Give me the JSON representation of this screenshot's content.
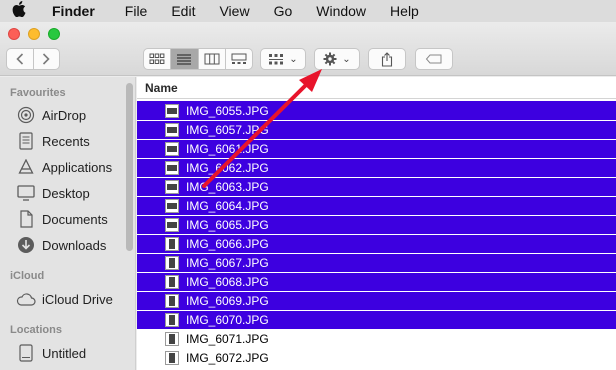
{
  "menubar": {
    "app": "Finder",
    "menus": [
      "File",
      "Edit",
      "View",
      "Go",
      "Window",
      "Help"
    ]
  },
  "sidebar": {
    "sections": [
      {
        "header": "Favourites",
        "items": [
          {
            "label": "AirDrop",
            "icon": "airdrop-icon"
          },
          {
            "label": "Recents",
            "icon": "recents-icon"
          },
          {
            "label": "Applications",
            "icon": "applications-icon"
          },
          {
            "label": "Desktop",
            "icon": "desktop-icon"
          },
          {
            "label": "Documents",
            "icon": "documents-icon"
          },
          {
            "label": "Downloads",
            "icon": "downloads-icon"
          }
        ]
      },
      {
        "header": "iCloud",
        "items": [
          {
            "label": "iCloud Drive",
            "icon": "cloud-icon"
          }
        ]
      },
      {
        "header": "Locations",
        "items": [
          {
            "label": "Untitled",
            "icon": "disk-icon"
          }
        ]
      }
    ]
  },
  "filelist": {
    "column_header": "Name",
    "files": [
      {
        "name": "IMG_6055.JPG",
        "selected": true,
        "orientation": "landscape"
      },
      {
        "name": "IMG_6057.JPG",
        "selected": true,
        "orientation": "landscape"
      },
      {
        "name": "IMG_6061.JPG",
        "selected": true,
        "orientation": "landscape"
      },
      {
        "name": "IMG_6062.JPG",
        "selected": true,
        "orientation": "landscape"
      },
      {
        "name": "IMG_6063.JPG",
        "selected": true,
        "orientation": "landscape"
      },
      {
        "name": "IMG_6064.JPG",
        "selected": true,
        "orientation": "landscape"
      },
      {
        "name": "IMG_6065.JPG",
        "selected": true,
        "orientation": "landscape"
      },
      {
        "name": "IMG_6066.JPG",
        "selected": true,
        "orientation": "portrait"
      },
      {
        "name": "IMG_6067.JPG",
        "selected": true,
        "orientation": "portrait"
      },
      {
        "name": "IMG_6068.JPG",
        "selected": true,
        "orientation": "portrait"
      },
      {
        "name": "IMG_6069.JPG",
        "selected": true,
        "orientation": "portrait"
      },
      {
        "name": "IMG_6070.JPG",
        "selected": true,
        "orientation": "portrait"
      },
      {
        "name": "IMG_6071.JPG",
        "selected": false,
        "orientation": "portrait"
      },
      {
        "name": "IMG_6072.JPG",
        "selected": false,
        "orientation": "portrait"
      }
    ]
  },
  "colors": {
    "selection": "#3d00e0",
    "arrow": "#e8142b"
  }
}
